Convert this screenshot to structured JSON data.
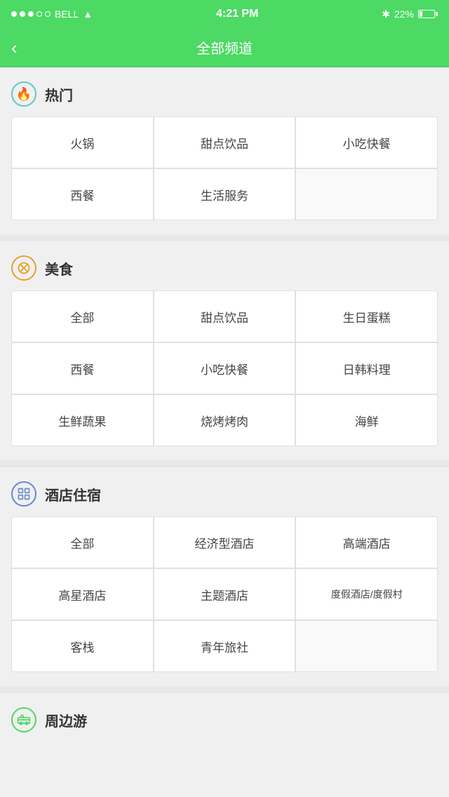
{
  "statusBar": {
    "carrier": "BELL",
    "time": "4:21 PM",
    "battery": "22%"
  },
  "navBar": {
    "title": "全部频道",
    "backLabel": "‹"
  },
  "sections": [
    {
      "id": "hot",
      "iconType": "hot",
      "iconSymbol": "🔥",
      "title": "热门",
      "items": [
        {
          "label": "火锅",
          "span": 1
        },
        {
          "label": "甜点饮品",
          "span": 1
        },
        {
          "label": "小吃快餐",
          "span": 1
        },
        {
          "label": "西餐",
          "span": 1
        },
        {
          "label": "生活服务",
          "span": 1
        }
      ]
    },
    {
      "id": "food",
      "iconType": "food",
      "iconSymbol": "✕",
      "title": "美食",
      "items": [
        {
          "label": "全部",
          "span": 1
        },
        {
          "label": "甜点饮品",
          "span": 1
        },
        {
          "label": "生日蛋糕",
          "span": 1
        },
        {
          "label": "西餐",
          "span": 1
        },
        {
          "label": "小吃快餐",
          "span": 1
        },
        {
          "label": "日韩料理",
          "span": 1
        },
        {
          "label": "生鲜蔬果",
          "span": 1
        },
        {
          "label": "烧烤烤肉",
          "span": 1
        },
        {
          "label": "海鲜",
          "span": 1
        }
      ]
    },
    {
      "id": "hotel",
      "iconType": "hotel",
      "iconSymbol": "⊞",
      "title": "酒店住宿",
      "items": [
        {
          "label": "全部",
          "span": 1
        },
        {
          "label": "经济型酒店",
          "span": 1
        },
        {
          "label": "高端酒店",
          "span": 1
        },
        {
          "label": "高星酒店",
          "span": 1
        },
        {
          "label": "主题酒店",
          "span": 1
        },
        {
          "label": "度假酒店/度假村",
          "span": 1
        },
        {
          "label": "客栈",
          "span": 1
        },
        {
          "label": "青年旅社",
          "span": 1
        }
      ]
    },
    {
      "id": "travel",
      "iconType": "travel",
      "iconSymbol": "🚌",
      "title": "周边游",
      "items": []
    }
  ]
}
